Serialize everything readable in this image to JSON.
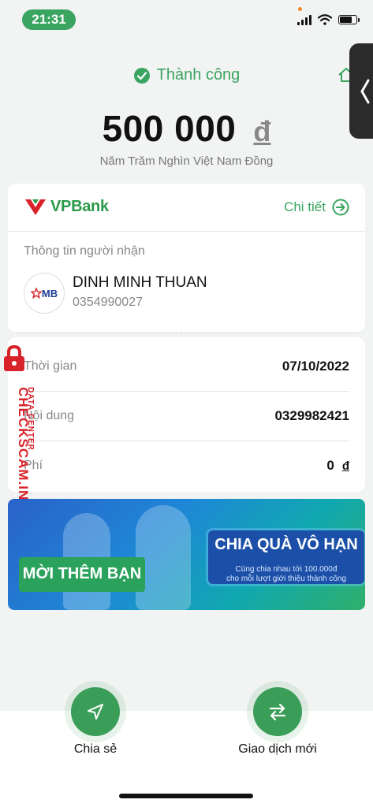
{
  "status_bar": {
    "time": "21:31"
  },
  "header": {
    "status_text": "Thành công",
    "amount": "500 000",
    "currency_symbol": "đ",
    "amount_in_words": "Năm Trăm Nghìn Việt Nam Đồng"
  },
  "bank": {
    "name": "VPBank",
    "detail_label": "Chi tiết"
  },
  "recipient": {
    "section_label": "Thông tin người nhận",
    "bank_code": "MB",
    "name": "DINH MINH THUAN",
    "account": "0354990027"
  },
  "details": [
    {
      "label": "Thời gian",
      "value": "07/10/2022"
    },
    {
      "label": "Nội dung",
      "value": "0329982421"
    },
    {
      "label": "Phí",
      "value": "0",
      "currency": "đ"
    }
  ],
  "banner": {
    "left_text": "MỜI THÊM BẠN",
    "right_heading": "CHIA QUÀ VÔ HẠN",
    "right_sub_1": "Cùng chia nhau tới 100.000đ",
    "right_sub_2": "cho mỗi lượt giới thiệu thành công"
  },
  "watermark": {
    "sub": "DATA CENTER",
    "main": "CHECKSCAM.INFO"
  },
  "actions": [
    {
      "label": "Chia sẻ",
      "icon": "send-icon"
    },
    {
      "label": "Giao dịch mới",
      "icon": "swap-icon"
    }
  ],
  "colors": {
    "accent": "#3aa560",
    "watermark": "#d8232a",
    "side_tab": "#2b2b2b"
  }
}
